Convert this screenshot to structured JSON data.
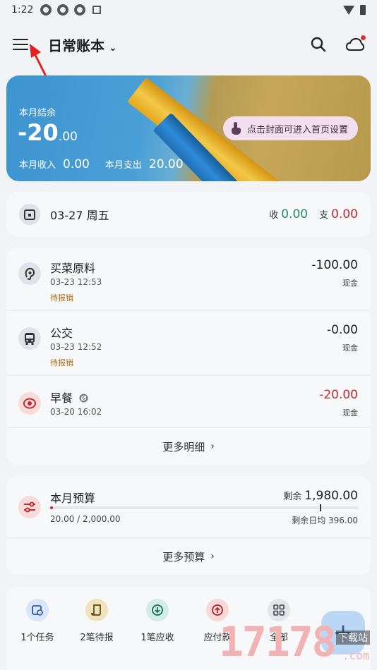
{
  "status_bar": {
    "time": "1:22"
  },
  "app_bar": {
    "title": "日常账本",
    "title_chevron": "⌄"
  },
  "cover": {
    "label": "本月结余",
    "balance_int": "-20",
    "balance_dec": ".00",
    "income_label": "本月收入",
    "income_value": "0.00",
    "expense_label": "本月支出",
    "expense_value": "20.00",
    "tip": "点击封面可进入首页设置"
  },
  "day_summary": {
    "date": "03-27 周五",
    "income_label": "收",
    "income": "0.00",
    "expense_label": "支",
    "expense": "0.00"
  },
  "transactions": [
    {
      "name": "买菜原料",
      "time": "03-23 12:53",
      "tag": "待报销",
      "amount": "-100.00",
      "account": "现金",
      "icon": "ear-icon"
    },
    {
      "name": "公交",
      "time": "03-23 12:52",
      "tag": "待报销",
      "amount": "-0.00",
      "account": "现金",
      "icon": "bus-icon"
    },
    {
      "name": "早餐",
      "time": "03-20 16:02",
      "amount": "-20.00",
      "account": "现金",
      "icon": "breakfast-icon"
    }
  ],
  "more_details": "更多明细",
  "budget": {
    "title": "本月预算",
    "remaining_label": "剩余",
    "remaining": "1,980.00",
    "used": "20.00 / 2,000.00",
    "daily": "剩余日均 396.00",
    "used_fraction": 0.01
  },
  "more_budget": "更多预算",
  "quick_actions": [
    {
      "label": "1个任务",
      "icon": "calendar-clock-icon",
      "color": "#d9e6fb"
    },
    {
      "label": "2笔待报",
      "icon": "receipt-icon",
      "color": "#efe2bd"
    },
    {
      "label": "1笔应收",
      "icon": "arrow-down-circle-icon",
      "color": "#cfeee6"
    },
    {
      "label": "应付款",
      "icon": "arrow-up-circle-icon",
      "color": "#f8d8d8"
    },
    {
      "label": "全部",
      "icon": "grid-icon",
      "color": "#e3e5ea"
    }
  ],
  "fab": {
    "label": "+"
  },
  "watermark": {
    "number": "17178",
    "site": "下载站",
    "domain": ".com"
  },
  "colors": {
    "income": "#1e8a5a",
    "expense": "#c42a2a",
    "tag": "#b06a10"
  }
}
